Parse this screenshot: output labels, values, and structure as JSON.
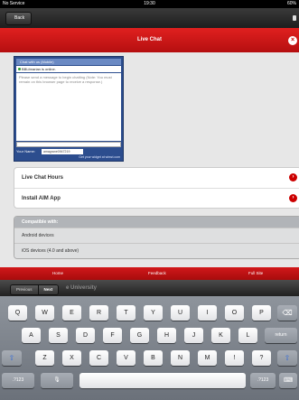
{
  "status_bar": {
    "carrier": "No Service",
    "time": "19:30",
    "battery": "60%"
  },
  "nav": {
    "back_label": "Back"
  },
  "header": {
    "title": "Live Chat",
    "close_glyph": "×"
  },
  "widget": {
    "title": "Chat with us (Mobile)",
    "status": "BBLibrarian is online.",
    "message_placeholder": "Please send a message to begin chatting (Note: You must remain on this browser page to receive a response.)",
    "name_label": "Your Name:",
    "name_value": "amagrane0947219",
    "footer_link": "Get your widget at wimzi.com"
  },
  "list": {
    "items": [
      {
        "label": "Live Chat Hours"
      },
      {
        "label": "Install AIM App"
      }
    ],
    "chevron": "›"
  },
  "compat": {
    "header": "Compatible with:",
    "rows": [
      "Android devices",
      "iOS devices (4.0 and above)"
    ]
  },
  "bottom_nav": {
    "home": "Home",
    "feedback": "Feedback",
    "full_site": "Full Site"
  },
  "form_assistant": {
    "previous": "Previous",
    "next": "Next",
    "ghost_text": "e University"
  },
  "keyboard": {
    "row1": [
      "Q",
      "W",
      "E",
      "R",
      "T",
      "Y",
      "U",
      "I",
      "O",
      "P"
    ],
    "row2": [
      "A",
      "S",
      "D",
      "F",
      "G",
      "H",
      "J",
      "K",
      "L"
    ],
    "row3": [
      "Z",
      "X",
      "C",
      "V",
      "B",
      "N",
      "M",
      "!",
      "?"
    ],
    "return_label": "return",
    "numbers_label": ".?123",
    "backspace_glyph": "⌫",
    "shift_glyph": "⇧",
    "mic_glyph": "🎙",
    "hide_glyph": "⌨"
  }
}
